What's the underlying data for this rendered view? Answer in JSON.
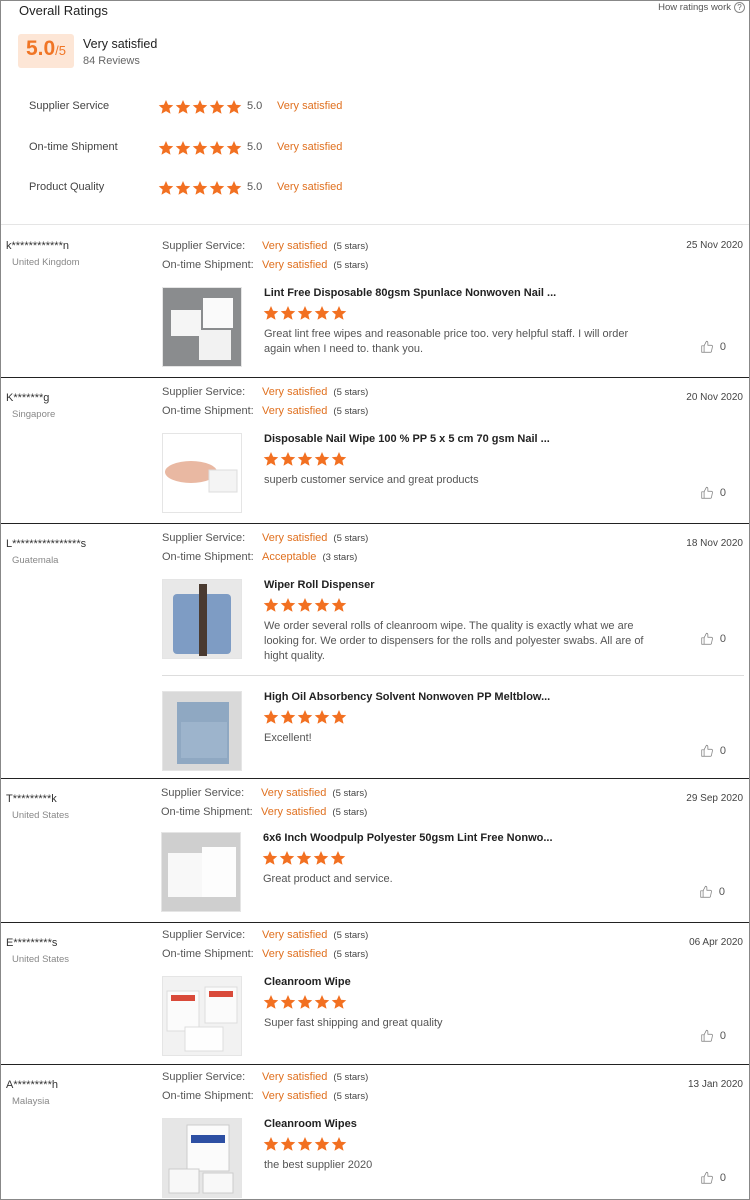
{
  "overall": {
    "title": "Overall Ratings",
    "how_link": "How ratings work",
    "score": "5.0",
    "score_out_of": "/5",
    "label": "Very satisfied",
    "reviews": "84 Reviews",
    "criteria": [
      {
        "name": "Supplier Service",
        "stars": 5,
        "value": "5.0",
        "text": "Very satisfied"
      },
      {
        "name": "On-time Shipment",
        "stars": 5,
        "value": "5.0",
        "text": "Very satisfied"
      },
      {
        "name": "Product Quality",
        "stars": 5,
        "value": "5.0",
        "text": "Very satisfied"
      }
    ]
  },
  "labels": {
    "supplier_service": "Supplier Service:",
    "ontime_shipment": "On-time Shipment:"
  },
  "reviews": [
    {
      "user": "k************n",
      "country": "United Kingdom",
      "date": "25 Nov 2020",
      "supplier": {
        "text": "Very satisfied",
        "count": "(5 stars)"
      },
      "shipment": {
        "text": "Very satisfied",
        "count": "(5 stars)"
      },
      "products": [
        {
          "title": "Lint Free Disposable 80gsm Spunlace Nonwoven Nail ...",
          "stars": 5,
          "comment": "Great lint free wipes and reasonable price too. very helpful staff. I will order again when I need to. thank you.",
          "likes": "0"
        }
      ]
    },
    {
      "user": "K*******g",
      "country": "Singapore",
      "date": "20 Nov 2020",
      "supplier": {
        "text": "Very satisfied",
        "count": "(5 stars)"
      },
      "shipment": {
        "text": "Very satisfied",
        "count": "(5 stars)"
      },
      "products": [
        {
          "title": "Disposable Nail Wipe 100 % PP 5 x 5 cm 70 gsm Nail ...",
          "stars": 5,
          "comment": "superb customer service and great products",
          "likes": "0"
        }
      ]
    },
    {
      "user": "L****************s",
      "country": "Guatemala",
      "date": "18 Nov 2020",
      "supplier": {
        "text": "Very satisfied",
        "count": "(5 stars)"
      },
      "shipment": {
        "text": "Acceptable",
        "count": "(3 stars)"
      },
      "products": [
        {
          "title": "Wiper Roll Dispenser",
          "stars": 5,
          "comment": "We order several rolls of cleanroom wipe. The quality is exactly what we are looking for. We order to dispensers for the rolls and polyester swabs. All are of hight quality.",
          "likes": "0"
        },
        {
          "title": "High Oil Absorbency Solvent Nonwoven PP Meltblow...",
          "stars": 5,
          "comment": "Excellent!",
          "likes": "0"
        }
      ]
    },
    {
      "user": "T*********k",
      "country": "United States",
      "date": "29 Sep 2020",
      "supplier": {
        "text": "Very satisfied",
        "count": "(5 stars)"
      },
      "shipment": {
        "text": "Very satisfied",
        "count": "(5 stars)"
      },
      "products": [
        {
          "title": "6x6 Inch Woodpulp Polyester 50gsm Lint Free Nonwo...",
          "stars": 5,
          "comment": "Great product and service.",
          "likes": "0"
        }
      ]
    },
    {
      "user": "E*********s",
      "country": "United States",
      "date": "06 Apr 2020",
      "supplier": {
        "text": "Very satisfied",
        "count": "(5 stars)"
      },
      "shipment": {
        "text": "Very satisfied",
        "count": "(5 stars)"
      },
      "products": [
        {
          "title": "Cleanroom Wipe",
          "stars": 5,
          "comment": "Super fast shipping and great quality",
          "likes": "0"
        }
      ]
    },
    {
      "user": "A*********h",
      "country": "Malaysia",
      "date": "13 Jan 2020",
      "supplier": {
        "text": "Very satisfied",
        "count": "(5 stars)"
      },
      "shipment": {
        "text": "Very satisfied",
        "count": "(5 stars)"
      },
      "products": [
        {
          "title": "Cleanroom Wipes",
          "stars": 5,
          "comment": "the best supplier 2020",
          "likes": "0"
        }
      ]
    }
  ]
}
